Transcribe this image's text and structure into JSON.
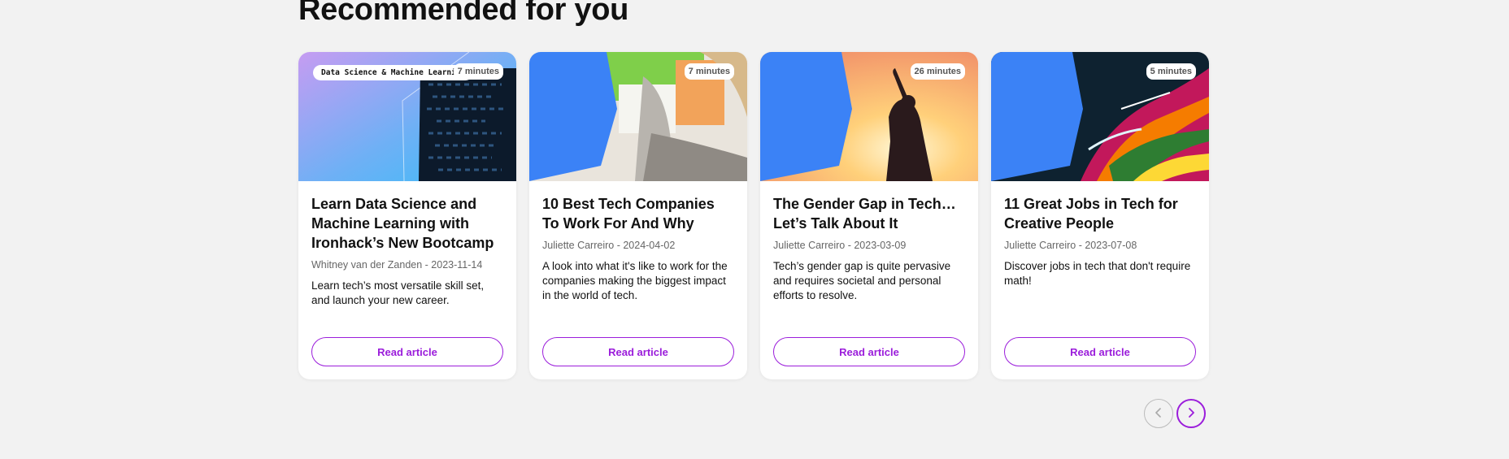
{
  "section": {
    "title": "Recommended for you"
  },
  "cards": [
    {
      "category": "Data Science & Machine Learning",
      "duration": "7 minutes",
      "title": "Learn Data Science and Machine Learning with Ironhack’s New Bootcamp",
      "meta": "Whitney van der Zanden - 2023-11-14",
      "description": "Learn tech’s most versatile skill set, and launch your new career.",
      "button": "Read article"
    },
    {
      "duration": "7 minutes",
      "title": "10 Best Tech Companies To Work For And Why",
      "meta": "Juliette Carreiro - 2024-04-02",
      "description": "A look into what it's like to work for the companies making the biggest impact in the world of tech.",
      "button": "Read article"
    },
    {
      "duration": "26 minutes",
      "title": "The Gender Gap in Tech… Let’s Talk About It",
      "meta": "Juliette Carreiro - 2023-03-09",
      "description": "Tech’s gender gap is quite pervasive and requires societal and personal efforts to resolve.",
      "button": "Read article"
    },
    {
      "duration": "5 minutes",
      "title": "11 Great Jobs in Tech for Creative People",
      "meta": "Juliette Carreiro - 2023-07-08",
      "description": "Discover jobs in tech that don't require math!",
      "button": "Read article"
    }
  ],
  "nav": {
    "prev_icon": "chevron-left-icon",
    "next_icon": "chevron-right-icon"
  },
  "colors": {
    "accent": "#9b1ddb",
    "blue": "#3b82f6",
    "background": "#f2f2f2"
  }
}
